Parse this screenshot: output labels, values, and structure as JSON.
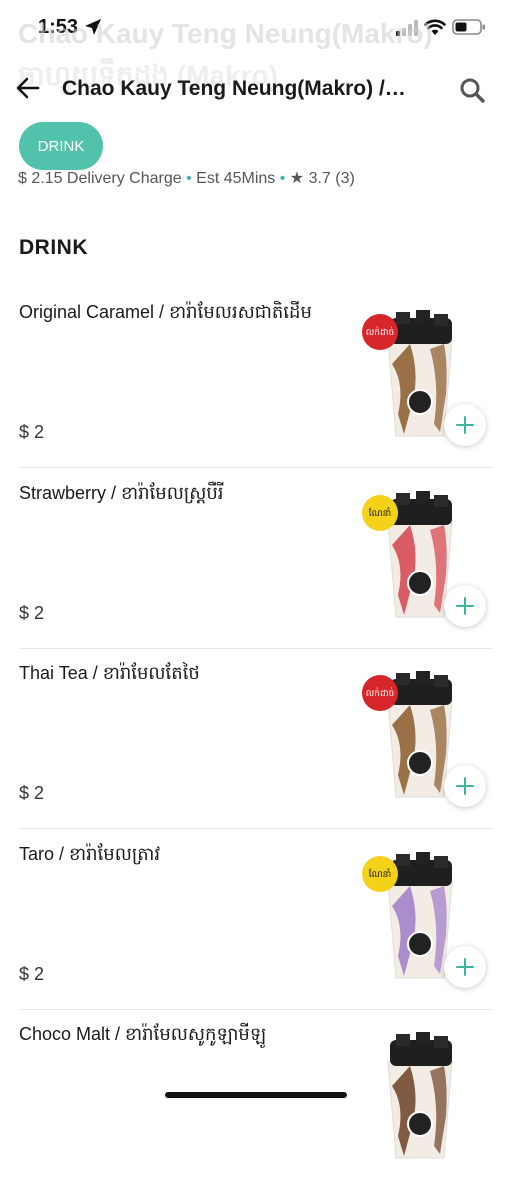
{
  "status_bar": {
    "time": "1:53"
  },
  "background_text": {
    "line1": "Chao Kauy Teng Neung(Makro)",
    "line2": "ចាហួយទឹកដូង (Makro)",
    "line4_fee": "$ 2.15 Delivery Charge",
    "line4_time": "Est 45Mins",
    "line4_rating": "★ 3.7 (3)"
  },
  "header": {
    "title": "Chao Kauy Teng Neung(Makro) /…"
  },
  "category_chip": {
    "label": "DRINK"
  },
  "section": {
    "title": "DRINK"
  },
  "items": [
    {
      "name": "Original Caramel / ខារ៉ាមែលរសជាតិដើម",
      "price": "$ 2",
      "badge": "លក់ដាច់",
      "badge_color": "#d7262a",
      "syrup": "#8a5a2b"
    },
    {
      "name": "Strawberry / ខារ៉ាមែលស្ត្របឺរី",
      "price": "$ 2",
      "badge": "ណែនាំ",
      "badge_color": "#f5d21a",
      "syrup": "#d4424c"
    },
    {
      "name": "Thai Tea / ខារ៉ាមែលតែថៃ",
      "price": "$ 2",
      "badge": "លក់ដាច់",
      "badge_color": "#d7262a",
      "syrup": "#8a5a2b"
    },
    {
      "name": "Taro / ខារ៉ាមែលត្រាវ",
      "price": "$ 2",
      "badge": "ណែនាំ",
      "badge_color": "#f5d21a",
      "syrup": "#9d7bc9"
    },
    {
      "name": "Choco Malt / ខារ៉ាមែលសូកូឡាមីឡូ",
      "price": "",
      "badge": "",
      "badge_color": "",
      "syrup": "#6b4226"
    }
  ],
  "colors": {
    "accent": "#53c2ac",
    "plus": "#3db3a0"
  }
}
